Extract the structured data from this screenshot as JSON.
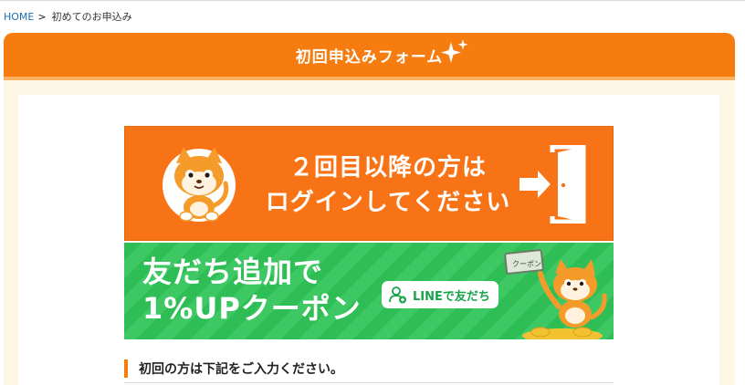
{
  "breadcrumb": {
    "home": "HOME",
    "separator": ">",
    "current": "初めてのお申込み"
  },
  "form": {
    "title": "初回申込みフォーム",
    "accent_color": "#f77c10"
  },
  "login_banner": {
    "line1": "２回目以降の方は",
    "line2": "ログインしてください",
    "icon": "door-login-icon",
    "color": "#f87315"
  },
  "line_banner": {
    "line1": "友だち追加で",
    "line2": "1%UPクーポン",
    "button_label": "LINEで友だち",
    "coupon_label": "クーポン",
    "color": "#2fbe55"
  },
  "notice": {
    "text": "初回の方は下記をご入力ください。"
  }
}
